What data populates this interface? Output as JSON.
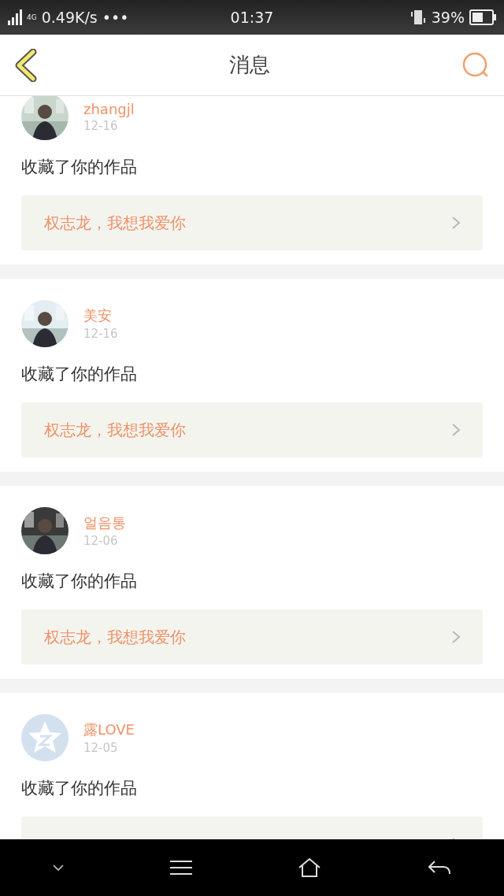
{
  "status_bar": {
    "network": "4G",
    "speed": "0.49K/s",
    "more": "•••",
    "time": "01:37",
    "battery": "39%"
  },
  "header": {
    "title": "消息"
  },
  "messages": [
    {
      "name": "zhangjl",
      "date": "12-16",
      "action": "收藏了你的作品",
      "work": "权志龙，我想我爱你"
    },
    {
      "name": "美安",
      "date": "12-16",
      "action": "收藏了你的作品",
      "work": "权志龙，我想我爱你"
    },
    {
      "name": "얼음통",
      "date": "12-06",
      "action": "收藏了你的作品",
      "work": "权志龙，我想我爱你"
    },
    {
      "name": "露LOVE",
      "date": "12-05",
      "action": "收藏了你的作品",
      "avatar": {
        "kind": "default",
        "color": "#d3e1ef"
      }
    }
  ]
}
